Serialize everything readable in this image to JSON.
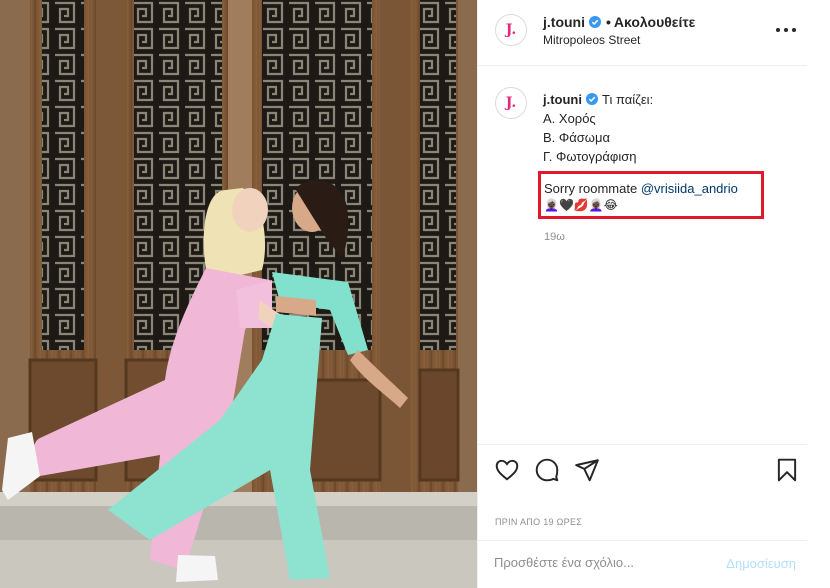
{
  "header": {
    "username": "j.touni",
    "separator": "•",
    "follow_status": "Ακολουθείτε",
    "location": "Mitropoleos Street",
    "avatar_letter": "J."
  },
  "caption": {
    "username": "j.touni",
    "intro": "Τι παίζει:",
    "lines": [
      "Α. Χορός",
      "Β. Φάσωμα",
      "Γ. Φωτογράφιση"
    ],
    "reply_prefix": "Sorry roommate",
    "mention": "@vrisiida_andrio",
    "emojis": "👩🏿‍🦳🖤💋👩🏿‍🦳😂",
    "time_ago": "19ω"
  },
  "actions": {
    "like_icon": "heart-icon",
    "comment_icon": "comment-icon",
    "share_icon": "paper-plane-icon",
    "save_icon": "bookmark-icon"
  },
  "timestamp": "ΠΡΙΝ ΑΠΟ 19 ΩΡΕΣ",
  "comment": {
    "placeholder": "Προσθέστε ένα σχόλιο...",
    "post_label": "Δημοσίευση"
  },
  "colors": {
    "verified": "#3897f0",
    "highlight_box": "#e0192e",
    "brand_pink": "#e02a7a",
    "mention": "#00376b"
  }
}
